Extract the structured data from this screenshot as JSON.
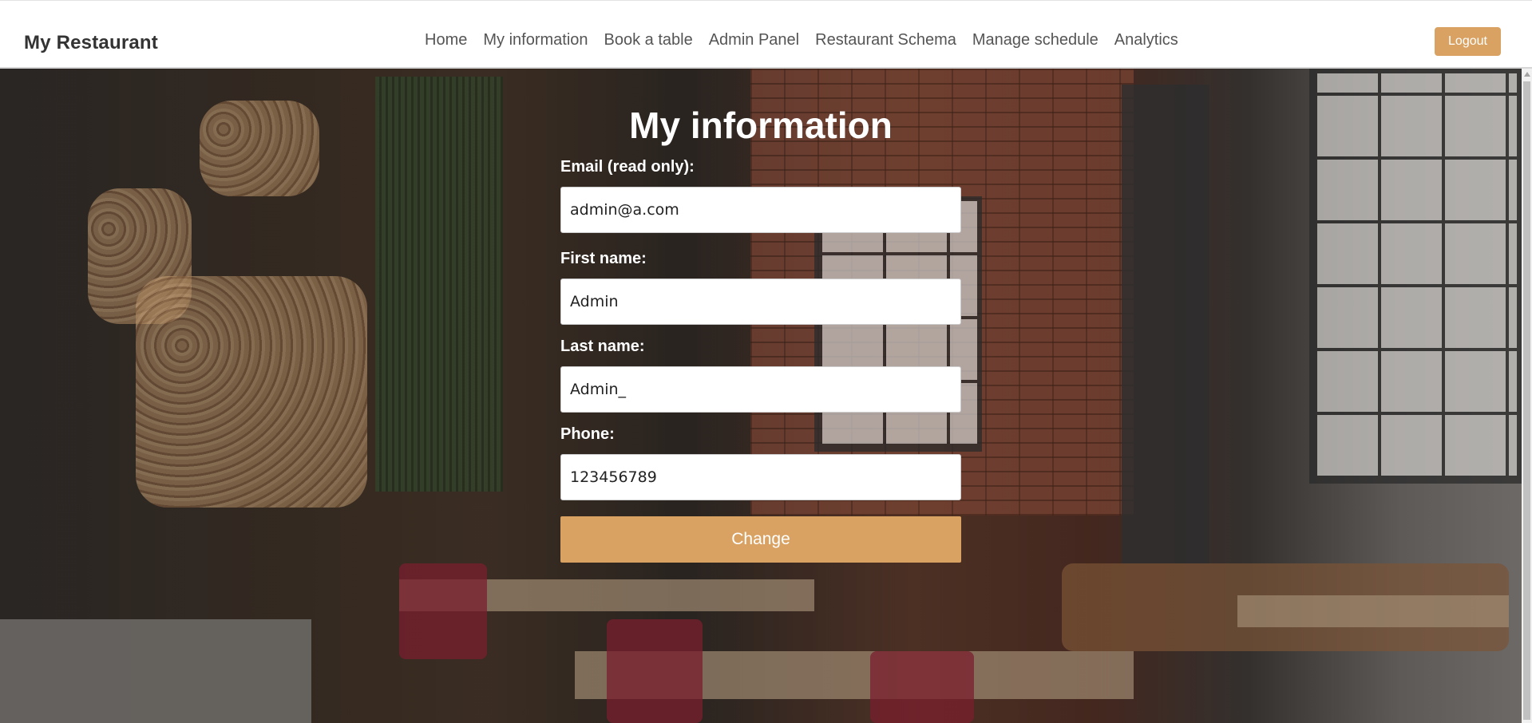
{
  "brand": "My Restaurant",
  "nav": [
    "Home",
    "My information",
    "Book a table",
    "Admin Panel",
    "Restaurant Schema",
    "Manage schedule",
    "Analytics"
  ],
  "logout_label": "Logout",
  "page_title": "My information",
  "fields": [
    {
      "label": "Email (read only):",
      "value": "admin@a.com"
    },
    {
      "label": "First name:",
      "value": "Admin"
    },
    {
      "label": "Last name:",
      "value": "Admin_"
    },
    {
      "label": "Phone:",
      "value": "123456789"
    }
  ],
  "submit_label": "Change",
  "colors": {
    "accent": "#d9a262",
    "navbar_bg": "#ffffff",
    "text_light": "#ffffff"
  }
}
